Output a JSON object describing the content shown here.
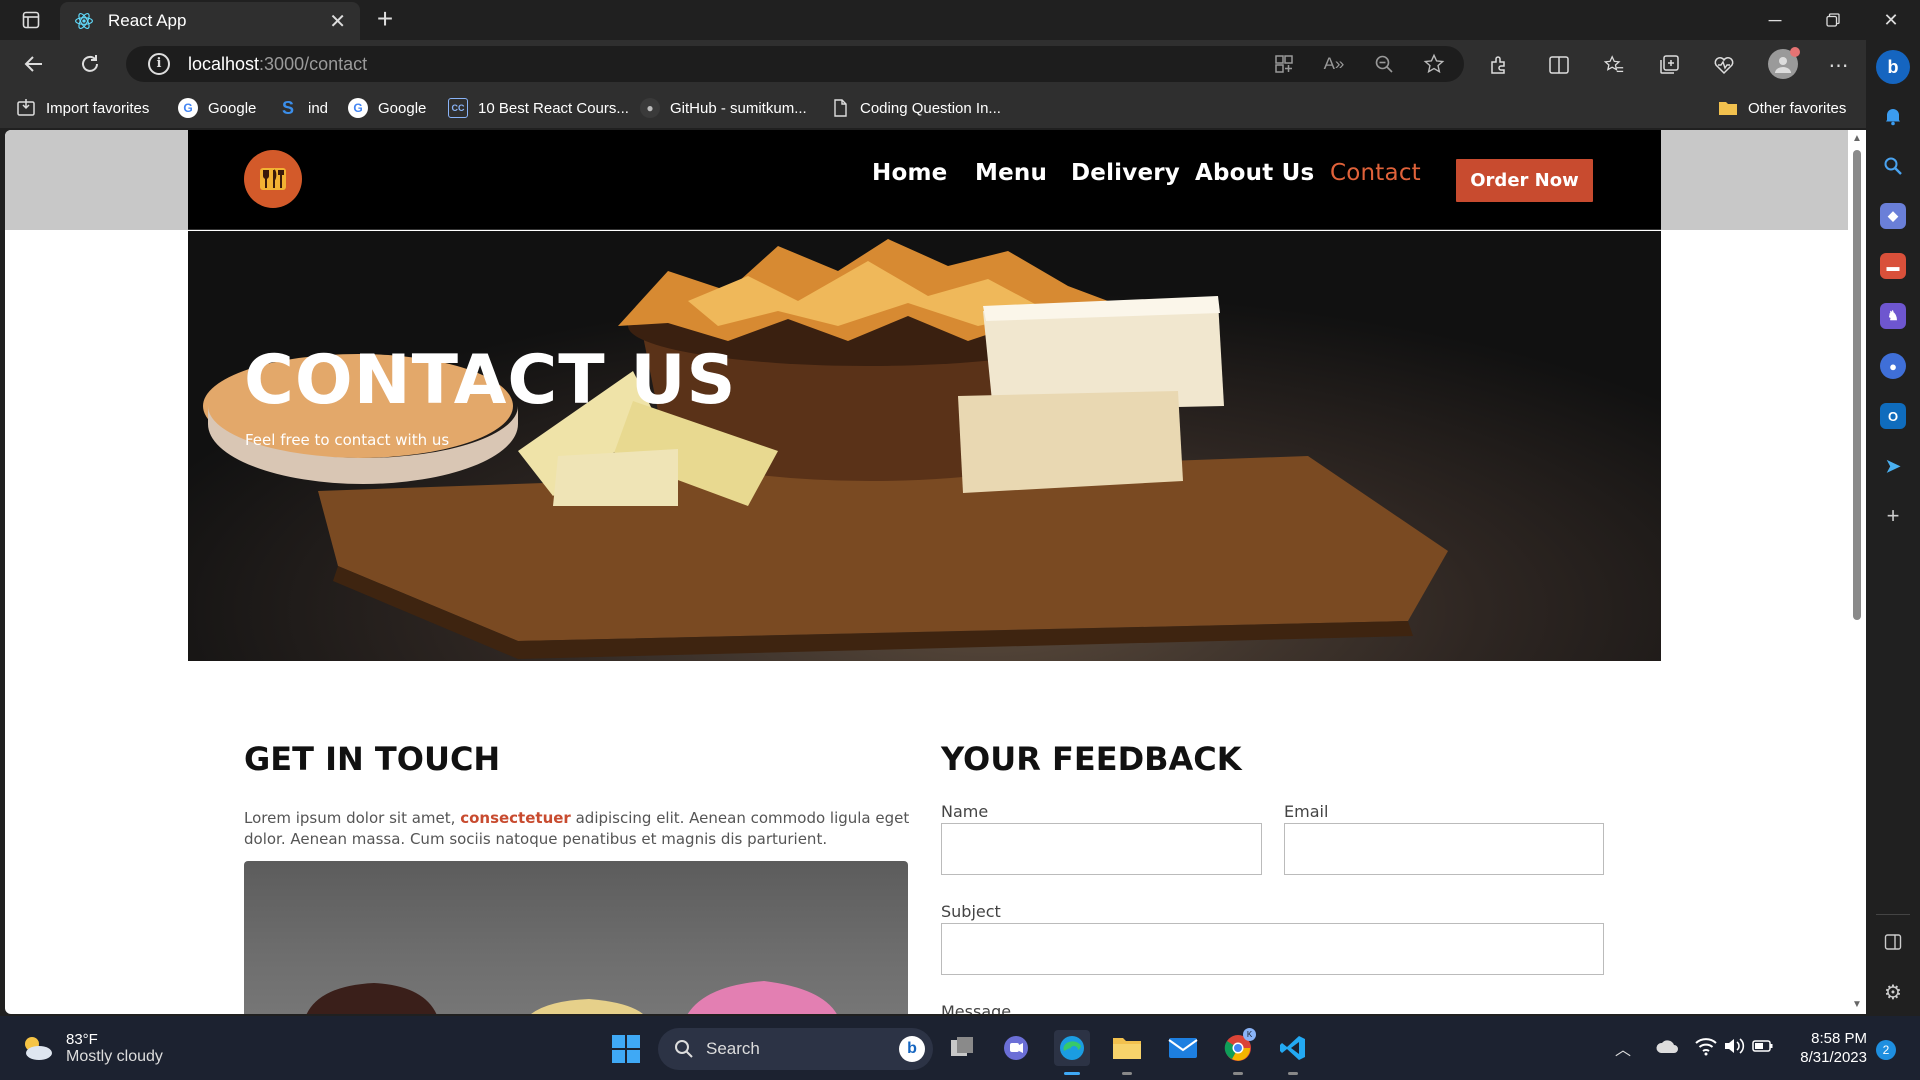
{
  "browser": {
    "tab_title": "React App",
    "url_host": "localhost",
    "url_path": ":3000/contact"
  },
  "favorites": [
    {
      "label": "Import favorites",
      "icon": "import-icon"
    },
    {
      "label": "Google",
      "icon": "google-icon"
    },
    {
      "label": "ind",
      "icon": "s-icon"
    },
    {
      "label": "Google",
      "icon": "google-icon"
    },
    {
      "label": "10 Best React Cours...",
      "icon": "course-icon"
    },
    {
      "label": "GitHub - sumitkum...",
      "icon": "github-icon"
    },
    {
      "label": "Coding Question In...",
      "icon": "page-icon"
    },
    {
      "label": "Other favorites",
      "icon": "folder-icon"
    }
  ],
  "site": {
    "nav": [
      "Home",
      "Menu",
      "Delivery",
      "About Us",
      "Contact"
    ],
    "active_nav": "Contact",
    "order_button": "Order Now",
    "accent_color": "#c84b2f"
  },
  "hero": {
    "title_light": "CONTACT",
    "title_bold": "US",
    "subtitle": "Feel free to contact with us"
  },
  "touch": {
    "title_light": "GET IN",
    "title_bold": "TOUCH",
    "text_before": "Lorem ipsum dolor sit amet,",
    "text_highlight": "consectetuer",
    "text_after": "adipiscing elit. Aenean commodo ligula eget dolor. Aenean massa. Cum sociis natoque penatibus et magnis dis parturient."
  },
  "feedback": {
    "title_light": "YOUR",
    "title_bold": "FEEDBACK",
    "name_label": "Name",
    "email_label": "Email",
    "subject_label": "Subject",
    "message_label": "Message",
    "name_value": "",
    "email_value": "",
    "subject_value": ""
  },
  "taskbar": {
    "temperature": "83°F",
    "condition": "Mostly cloudy",
    "search_label": "Search",
    "time": "8:58 PM",
    "date": "8/31/2023",
    "notifications": "2"
  }
}
